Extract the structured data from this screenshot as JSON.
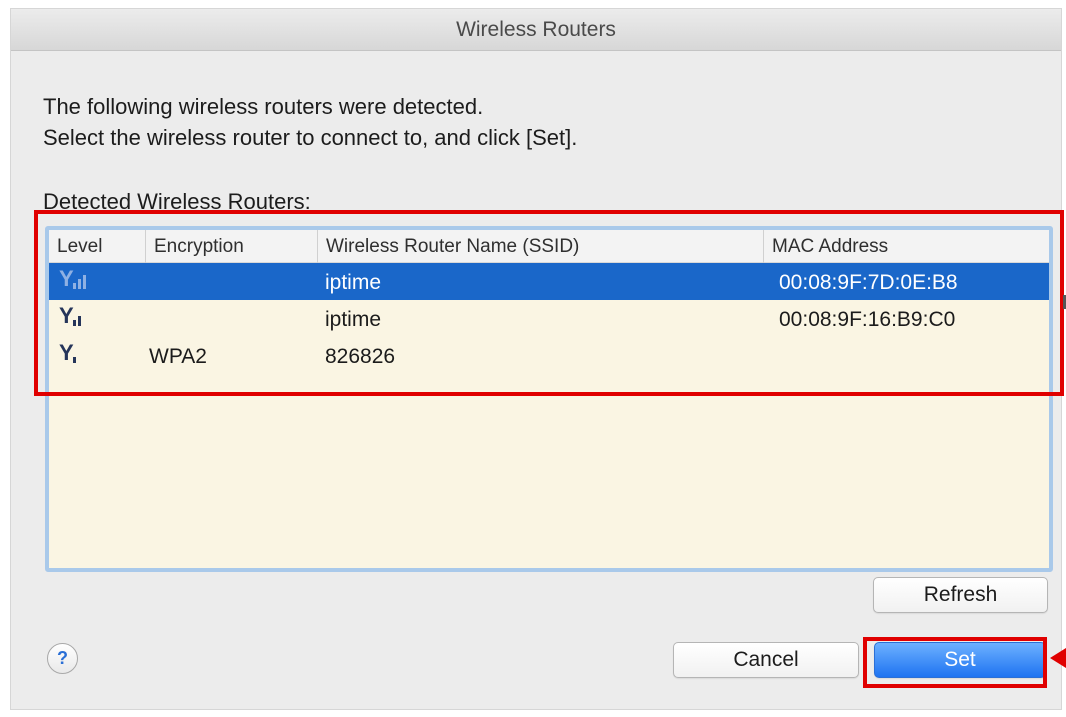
{
  "window": {
    "title": "Wireless Routers"
  },
  "description": {
    "line1": "The following wireless routers were detected.",
    "line2": "Select the wireless router to connect to, and click [Set]."
  },
  "section_label": "Detected Wireless Routers:",
  "table": {
    "columns": [
      "Level",
      "Encryption",
      "Wireless Router Name (SSID)",
      "MAC Address"
    ],
    "rows": [
      {
        "level": 2,
        "encryption": "",
        "ssid": "iptime",
        "mac": "00:08:9F:7D:0E:B8",
        "selected": true
      },
      {
        "level": 2,
        "encryption": "",
        "ssid": "iptime",
        "mac": "00:08:9F:16:B9:C0",
        "selected": false
      },
      {
        "level": 1,
        "encryption": "WPA2",
        "ssid": "826826",
        "mac": "",
        "selected": false
      }
    ]
  },
  "buttons": {
    "refresh": "Refresh",
    "cancel": "Cancel",
    "set": "Set",
    "help": "?"
  },
  "colors": {
    "selection": "#1a67c9",
    "highlight": "#e00000",
    "list_background": "#faf5e3",
    "primary_button": "#1e73f1"
  },
  "icons": {
    "signal": "signal-strength-icon",
    "help": "help-icon",
    "arrow": "arrow-left-icon"
  }
}
